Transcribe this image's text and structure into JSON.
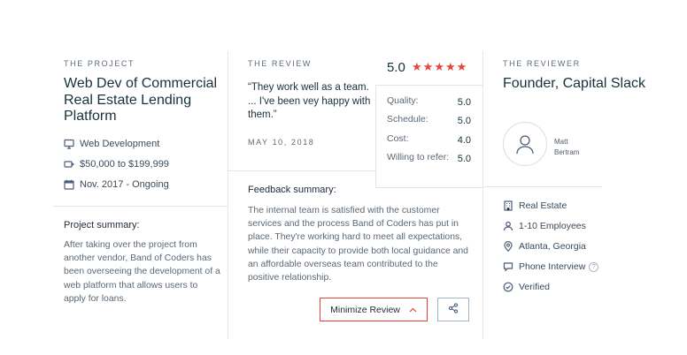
{
  "project": {
    "eyebrow": "THE PROJECT",
    "title": "Web Dev of Commercial Real Estate Lending Platform",
    "service": "Web Development",
    "budget": "$50,000 to $199,999",
    "timeline": "Nov. 2017 - Ongoing",
    "summary_label": "Project summary:",
    "summary_text": "After taking over the project from another vendor, Band of Coders has been overseeing the development of a web platform that allows users to apply for loans."
  },
  "review": {
    "eyebrow": "THE REVIEW",
    "quote": "“They work well as a team. ... I've been vey happy with them.”",
    "date": "MAY 10, 2018",
    "overall": "5.0",
    "star_count": 5,
    "ratings": [
      {
        "label": "Quality:",
        "value": "5.0"
      },
      {
        "label": "Schedule:",
        "value": "5.0"
      },
      {
        "label": "Cost:",
        "value": "4.0"
      },
      {
        "label": "Willing to refer:",
        "value": "5.0"
      }
    ],
    "feedback_label": "Feedback summary:",
    "feedback_text": "The internal team is satisfied with the customer services and the process Band of Coders has put in place. They're working hard to meet all expectations, while their capacity to provide both local guidance and an affordable overseas team contributed to the positive relationship.",
    "minimize_label": "Minimize Review"
  },
  "reviewer": {
    "eyebrow": "THE REVIEWER",
    "title": "Founder, Capital Slack",
    "name_first": "Matt",
    "name_last": "Bertram",
    "industry": "Real Estate",
    "size": "1-10 Employees",
    "location": "Atlanta, Georgia",
    "review_type": "Phone Interview",
    "help_mark": "?",
    "status": "Verified"
  },
  "colors": {
    "accent": "#e8433a",
    "divider": "#dfe6ee",
    "icon": "#4a5d7a"
  },
  "icons": {
    "service": "monitor-icon",
    "budget": "tag-icon",
    "timeline": "calendar-icon",
    "share": "share-icon",
    "chevron": "chevron-up-icon",
    "industry": "building-icon",
    "size": "user-icon",
    "location": "location-pin-icon",
    "review_type": "chat-icon",
    "status": "check-circle-icon",
    "avatar": "user-avatar-icon"
  }
}
